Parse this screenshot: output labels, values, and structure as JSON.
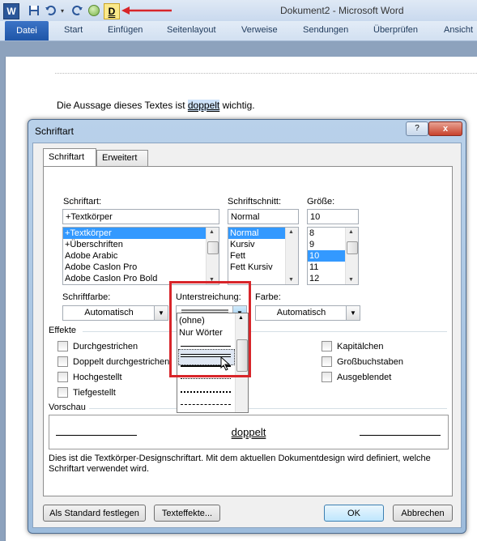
{
  "window": {
    "title": "Dokument2 - Microsoft Word",
    "qat": {
      "logo": "W",
      "save_icon": "save-icon",
      "undo_icon": "undo-icon",
      "redo_icon": "redo-icon",
      "double_underline_label": "D"
    }
  },
  "ribbon": {
    "tabs": [
      "Datei",
      "Start",
      "Einfügen",
      "Seitenlayout",
      "Verweise",
      "Sendungen",
      "Überprüfen",
      "Ansicht"
    ]
  },
  "document": {
    "text_before": "Die Aussage dieses Textes ist ",
    "selected_word": "doppelt",
    "text_after": " wichtig."
  },
  "dialog": {
    "title": "Schriftart",
    "help_label": "?",
    "close_label": "x",
    "tabs": [
      "Schriftart",
      "Erweitert"
    ],
    "font_label": "Schriftart:",
    "font_value": "+Textkörper",
    "font_list": [
      "+Textkörper",
      "+Überschriften",
      "Adobe Arabic",
      "Adobe Caslon Pro",
      "Adobe Caslon Pro Bold"
    ],
    "style_label": "Schriftschnitt:",
    "style_value": "Normal",
    "style_list": [
      "Normal",
      "Kursiv",
      "Fett",
      "Fett Kursiv"
    ],
    "size_label": "Größe:",
    "size_value": "10",
    "size_list": [
      "8",
      "9",
      "10",
      "11",
      "12"
    ],
    "font_color_label": "Schriftfarbe:",
    "font_color_value": "Automatisch",
    "underline_label": "Unterstreichung:",
    "underline_color_label": "Farbe:",
    "underline_color_value": "Automatisch",
    "effects_label": "Effekte",
    "effects_left": [
      "Durchgestrichen",
      "Doppelt durchgestrichen",
      "Hochgestellt",
      "Tiefgestellt"
    ],
    "effects_right": [
      "Kapitälchen",
      "Großbuchstaben",
      "Ausgeblendet"
    ],
    "underline_options": [
      "(ohne)",
      "Nur Wörter"
    ],
    "preview_label": "Vorschau",
    "preview_text": "doppelt",
    "description": "Dies ist die Textkörper-Designschriftart. Mit dem aktuellen Dokumentdesign wird definiert, welche Schriftart verwendet wird.",
    "btn_default": "Als Standard festlegen",
    "btn_effects": "Texteffekte...",
    "btn_ok": "OK",
    "btn_cancel": "Abbrechen"
  },
  "colors": {
    "highlight": "#d8252a",
    "selection": "#3399ff",
    "file_tab": "#2b579a"
  }
}
